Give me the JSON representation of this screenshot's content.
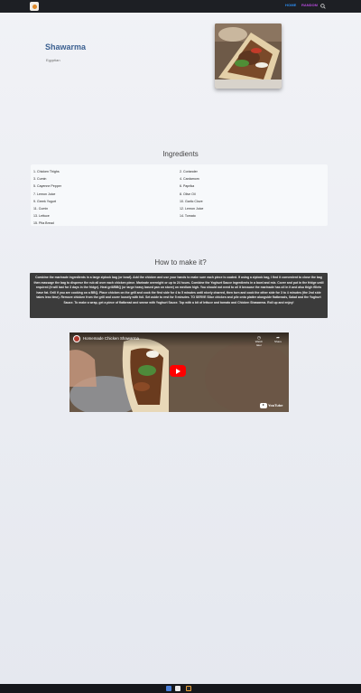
{
  "nav": {
    "home_label": "HOME",
    "random_label": "RANDOM",
    "search_icon": "search-icon",
    "logo_icon": "meal-logo-icon"
  },
  "meal": {
    "name": "Shawarma",
    "area": "Egyptian"
  },
  "ingredients": {
    "title": "Ingredients",
    "left": [
      "1. Chicken Thighs",
      "3. Cumin",
      "5. Cayenne Pepper",
      "7. Lemon Juice",
      "9. Greek Yogurt",
      "11. Cumin",
      "13. Lettuce",
      "15. Pita Bread"
    ],
    "right": [
      "2. Coriander",
      "4. Cardamom",
      "6. Paprika",
      "8. Olive Oil",
      "10. Garlic Clove",
      "12. Lemon Juice",
      "14. Tomato"
    ]
  },
  "instructions": {
    "title": "How to make it?",
    "text": "Combine the marinade ingredients in a large ziplock bag (or bowl). Add the chicken and use your hands to make sure each piece is coated. If using a ziplock bag, I find it convenient to close the bag then massage the bag to disperse the rub all over each chicken piece. Marinate overnight or up to 24 hours. Combine the Yoghurt Sauce ingredients in a bowl and mix. Cover and put in the fridge until required (it will last for 3 days in the fridge). Heat grill/BBQ (or large heavy based pan on stove) on medium high. You should not need to oil it because the marinade has oil in it and also thigh fillets have fat. Grill if you are cooking on a BBQ. Place chicken on the grill and cook the first side for 4 to 5 minutes until nicely charred, then turn and cook the other side for 3 to 4 minutes (the 2nd side takes less time). Remove chicken from the grill and cover loosely with foil. Set aside to rest for 5 minutes. TO SERVE Slice chicken and pile onto platter alongside flatbreads, Salad and the Yoghurt Sauce. To make a wrap, get a piece of flatbread and smear with Yoghurt Sauce. Top with a bit of lettuce and tomato and Chicken Shawarma. Roll up and enjoy!"
  },
  "video": {
    "title": "Homemade Chicken Shawarma",
    "watch_later_label": "Watch later",
    "share_label": "Share",
    "brand_label": "YouTube",
    "play_icon": "play-icon"
  }
}
